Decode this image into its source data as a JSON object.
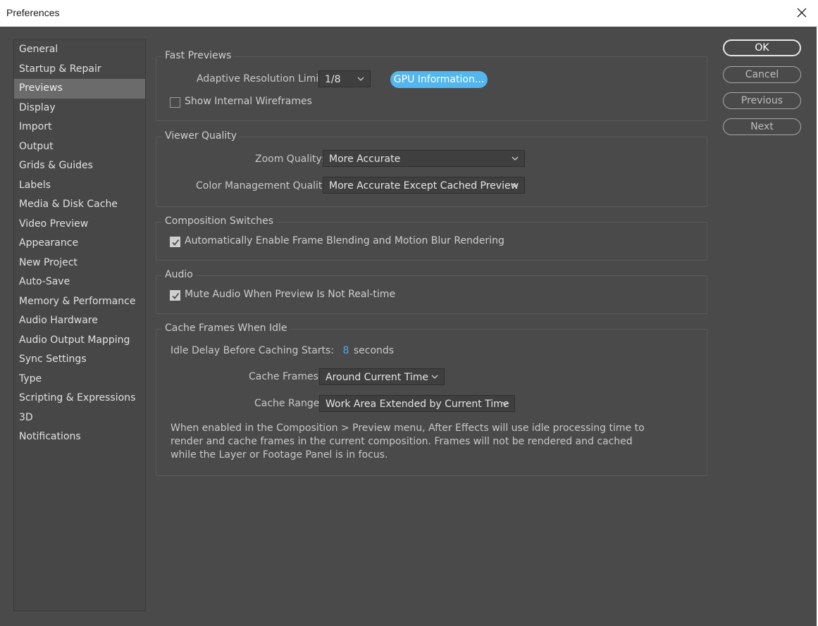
{
  "window": {
    "title": "Preferences"
  },
  "sidebar": {
    "items": [
      {
        "label": "General"
      },
      {
        "label": "Startup & Repair"
      },
      {
        "label": "Previews"
      },
      {
        "label": "Display"
      },
      {
        "label": "Import"
      },
      {
        "label": "Output"
      },
      {
        "label": "Grids & Guides"
      },
      {
        "label": "Labels"
      },
      {
        "label": "Media & Disk Cache"
      },
      {
        "label": "Video Preview"
      },
      {
        "label": "Appearance"
      },
      {
        "label": "New Project"
      },
      {
        "label": "Auto-Save"
      },
      {
        "label": "Memory & Performance"
      },
      {
        "label": "Audio Hardware"
      },
      {
        "label": "Audio Output Mapping"
      },
      {
        "label": "Sync Settings"
      },
      {
        "label": "Type"
      },
      {
        "label": "Scripting & Expressions"
      },
      {
        "label": "3D"
      },
      {
        "label": "Notifications"
      }
    ],
    "selected": "Previews"
  },
  "fast_previews": {
    "legend": "Fast Previews",
    "adaptive_label": "Adaptive Resolution Limit:",
    "adaptive_value": "1/8",
    "gpu_button": "GPU Information...",
    "show_wireframes_label": "Show Internal Wireframes",
    "show_wireframes_checked": false
  },
  "viewer_quality": {
    "legend": "Viewer Quality",
    "zoom_label": "Zoom Quality:",
    "zoom_value": "More Accurate",
    "color_label": "Color Management Quality:",
    "color_value": "More Accurate Except Cached Preview"
  },
  "composition_switches": {
    "legend": "Composition Switches",
    "auto_enable_label": "Automatically Enable Frame Blending and Motion Blur Rendering",
    "auto_enable_checked": true
  },
  "audio": {
    "legend": "Audio",
    "mute_label": "Mute Audio When Preview Is Not Real-time",
    "mute_checked": true
  },
  "cache_frames": {
    "legend": "Cache Frames When Idle",
    "idle_delay_label": "Idle Delay Before Caching Starts:",
    "idle_delay_value": "8",
    "idle_delay_unit": "seconds",
    "cache_frames_label": "Cache Frames:",
    "cache_frames_value": "Around Current Time",
    "cache_range_label": "Cache Range:",
    "cache_range_value": "Work Area Extended by Current Time",
    "description": "When enabled in the Composition > Preview menu, After Effects will use idle processing time to render and cache frames in the current composition. Frames will not be rendered and cached while the Layer or Footage Panel is in focus."
  },
  "buttons": {
    "ok": "OK",
    "cancel": "Cancel",
    "previous": "Previous",
    "next": "Next"
  },
  "colors": {
    "background": "#4a4a4a",
    "accent": "#53b6ee",
    "value_blue": "#4ea8e8"
  },
  "icons": {
    "close": "close-icon",
    "dropdown": "chevron-down-icon",
    "check": "check-icon"
  }
}
